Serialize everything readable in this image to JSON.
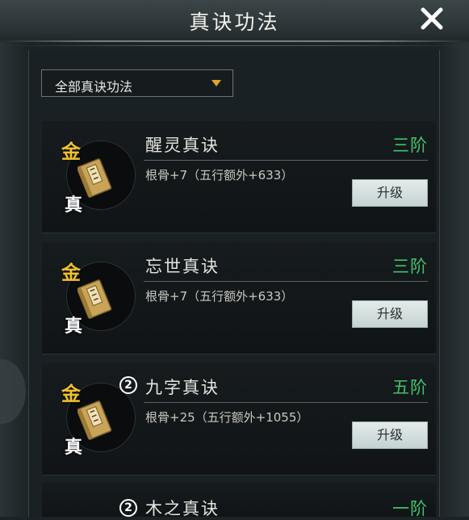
{
  "window": {
    "title": "真诀功法"
  },
  "filter": {
    "label": "全部真诀功法"
  },
  "techniques": [
    {
      "grade": "金",
      "type": "真",
      "badge": "",
      "name": "醒灵真诀",
      "tier": "三阶",
      "stat": "根骨+7（五行额外+633）",
      "upgrade_label": "升级"
    },
    {
      "grade": "金",
      "type": "真",
      "badge": "",
      "name": "忘世真诀",
      "tier": "三阶",
      "stat": "根骨+7（五行额外+633）",
      "upgrade_label": "升级"
    },
    {
      "grade": "金",
      "type": "真",
      "badge": "2",
      "name": "九字真诀",
      "tier": "五阶",
      "stat": "根骨+25（五行额外+1055）",
      "upgrade_label": "升级"
    }
  ],
  "partial_item": {
    "badge": "2",
    "name": "木之真诀",
    "tier": "一阶"
  },
  "colors": {
    "grade": "#f0c030",
    "tier": "#3fc36a",
    "arrow": "#e3a22c"
  },
  "icons": {
    "close": "close-icon",
    "dropdown": "triangle-down-icon",
    "item": "scroll-book-icon"
  }
}
